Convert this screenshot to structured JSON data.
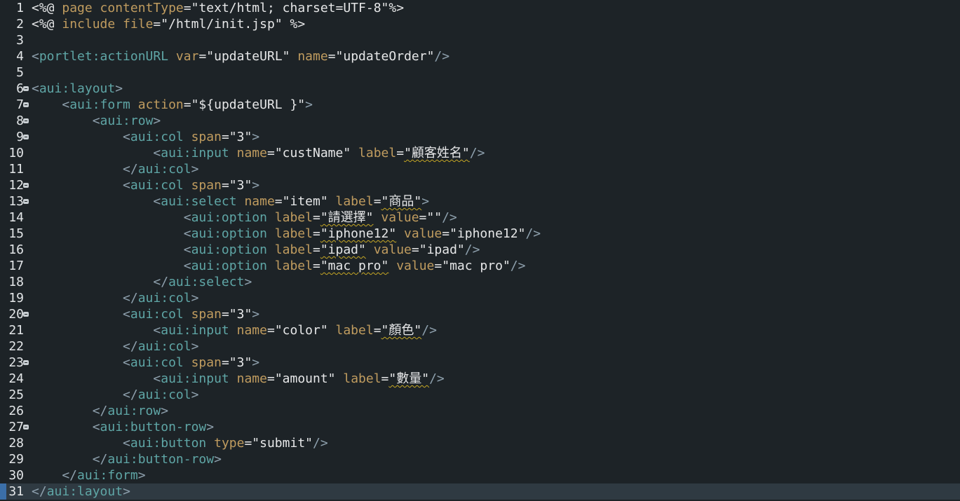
{
  "editor": {
    "lines": [
      {
        "num": "1",
        "fold": false,
        "current": false,
        "tokens": [
          {
            "t": "<%@ ",
            "c": "dir"
          },
          {
            "t": "page ",
            "c": "attr"
          },
          {
            "t": "contentType",
            "c": "attr"
          },
          {
            "t": "=",
            "c": "eq"
          },
          {
            "t": "\"text/html; charset=UTF-8\"",
            "c": "str"
          },
          {
            "t": "%>",
            "c": "dir"
          }
        ]
      },
      {
        "num": "2",
        "fold": false,
        "current": false,
        "tokens": [
          {
            "t": "<%@ ",
            "c": "dir"
          },
          {
            "t": "include ",
            "c": "attr"
          },
          {
            "t": "file",
            "c": "attr"
          },
          {
            "t": "=",
            "c": "eq"
          },
          {
            "t": "\"/html/init.jsp\"",
            "c": "str"
          },
          {
            "t": " %>",
            "c": "dir"
          }
        ]
      },
      {
        "num": "3",
        "fold": false,
        "current": false,
        "tokens": []
      },
      {
        "num": "4",
        "fold": false,
        "current": false,
        "tokens": [
          {
            "t": "<",
            "c": "br"
          },
          {
            "t": "portlet:actionURL",
            "c": "tag"
          },
          {
            "t": " var",
            "c": "attr"
          },
          {
            "t": "=",
            "c": "eq"
          },
          {
            "t": "\"updateURL\"",
            "c": "str"
          },
          {
            "t": " name",
            "c": "attr"
          },
          {
            "t": "=",
            "c": "eq"
          },
          {
            "t": "\"updateOrder\"",
            "c": "str"
          },
          {
            "t": "/>",
            "c": "br"
          }
        ]
      },
      {
        "num": "5",
        "fold": false,
        "current": false,
        "tokens": []
      },
      {
        "num": "6",
        "fold": true,
        "current": false,
        "tokens": [
          {
            "t": "<",
            "c": "br"
          },
          {
            "t": "aui:layout",
            "c": "tag"
          },
          {
            "t": ">",
            "c": "br"
          }
        ]
      },
      {
        "num": "7",
        "fold": true,
        "current": false,
        "tokens": [
          {
            "t": "    <",
            "c": "br"
          },
          {
            "t": "aui:form",
            "c": "tag"
          },
          {
            "t": " action",
            "c": "attr"
          },
          {
            "t": "=",
            "c": "eq"
          },
          {
            "t": "\"${updateURL }\"",
            "c": "str"
          },
          {
            "t": ">",
            "c": "br"
          }
        ]
      },
      {
        "num": "8",
        "fold": true,
        "current": false,
        "tokens": [
          {
            "t": "        <",
            "c": "br"
          },
          {
            "t": "aui:row",
            "c": "tag"
          },
          {
            "t": ">",
            "c": "br"
          }
        ]
      },
      {
        "num": "9",
        "fold": true,
        "current": false,
        "tokens": [
          {
            "t": "            <",
            "c": "br"
          },
          {
            "t": "aui:col",
            "c": "tag"
          },
          {
            "t": " span",
            "c": "attr"
          },
          {
            "t": "=",
            "c": "eq"
          },
          {
            "t": "\"3\"",
            "c": "str"
          },
          {
            "t": ">",
            "c": "br"
          }
        ]
      },
      {
        "num": "10",
        "fold": false,
        "current": false,
        "tokens": [
          {
            "t": "                <",
            "c": "br"
          },
          {
            "t": "aui:input",
            "c": "tag"
          },
          {
            "t": " name",
            "c": "attr"
          },
          {
            "t": "=",
            "c": "eq"
          },
          {
            "t": "\"custName\"",
            "c": "str"
          },
          {
            "t": " label",
            "c": "attr"
          },
          {
            "t": "=",
            "c": "eq"
          },
          {
            "t": "\"顧客姓名\"",
            "c": "str",
            "spell": true
          },
          {
            "t": "/>",
            "c": "br"
          }
        ]
      },
      {
        "num": "11",
        "fold": false,
        "current": false,
        "tokens": [
          {
            "t": "            </",
            "c": "br"
          },
          {
            "t": "aui:col",
            "c": "tag"
          },
          {
            "t": ">",
            "c": "br"
          }
        ]
      },
      {
        "num": "12",
        "fold": true,
        "current": false,
        "tokens": [
          {
            "t": "            <",
            "c": "br"
          },
          {
            "t": "aui:col",
            "c": "tag"
          },
          {
            "t": " span",
            "c": "attr"
          },
          {
            "t": "=",
            "c": "eq"
          },
          {
            "t": "\"3\"",
            "c": "str"
          },
          {
            "t": ">",
            "c": "br"
          }
        ]
      },
      {
        "num": "13",
        "fold": true,
        "current": false,
        "tokens": [
          {
            "t": "                <",
            "c": "br"
          },
          {
            "t": "aui:select",
            "c": "tag"
          },
          {
            "t": " name",
            "c": "attr"
          },
          {
            "t": "=",
            "c": "eq"
          },
          {
            "t": "\"item\"",
            "c": "str"
          },
          {
            "t": " label",
            "c": "attr"
          },
          {
            "t": "=",
            "c": "eq"
          },
          {
            "t": "\"商品\"",
            "c": "str",
            "spell": true
          },
          {
            "t": ">",
            "c": "br"
          }
        ]
      },
      {
        "num": "14",
        "fold": false,
        "current": false,
        "tokens": [
          {
            "t": "                    <",
            "c": "br"
          },
          {
            "t": "aui:option",
            "c": "tag"
          },
          {
            "t": " label",
            "c": "attr"
          },
          {
            "t": "=",
            "c": "eq"
          },
          {
            "t": "\"請選擇\"",
            "c": "str",
            "spell": true
          },
          {
            "t": " value",
            "c": "attr"
          },
          {
            "t": "=",
            "c": "eq"
          },
          {
            "t": "\"\"",
            "c": "str"
          },
          {
            "t": "/>",
            "c": "br"
          }
        ]
      },
      {
        "num": "15",
        "fold": false,
        "current": false,
        "tokens": [
          {
            "t": "                    <",
            "c": "br"
          },
          {
            "t": "aui:option",
            "c": "tag"
          },
          {
            "t": " label",
            "c": "attr"
          },
          {
            "t": "=",
            "c": "eq"
          },
          {
            "t": "\"iphone12\"",
            "c": "str",
            "spell": true
          },
          {
            "t": " value",
            "c": "attr"
          },
          {
            "t": "=",
            "c": "eq"
          },
          {
            "t": "\"iphone12\"",
            "c": "str"
          },
          {
            "t": "/>",
            "c": "br"
          }
        ]
      },
      {
        "num": "16",
        "fold": false,
        "current": false,
        "tokens": [
          {
            "t": "                    <",
            "c": "br"
          },
          {
            "t": "aui:option",
            "c": "tag"
          },
          {
            "t": " label",
            "c": "attr"
          },
          {
            "t": "=",
            "c": "eq"
          },
          {
            "t": "\"ipad\"",
            "c": "str",
            "spell": true
          },
          {
            "t": " value",
            "c": "attr"
          },
          {
            "t": "=",
            "c": "eq"
          },
          {
            "t": "\"ipad\"",
            "c": "str"
          },
          {
            "t": "/>",
            "c": "br"
          }
        ]
      },
      {
        "num": "17",
        "fold": false,
        "current": false,
        "tokens": [
          {
            "t": "                    <",
            "c": "br"
          },
          {
            "t": "aui:option",
            "c": "tag"
          },
          {
            "t": " label",
            "c": "attr"
          },
          {
            "t": "=",
            "c": "eq"
          },
          {
            "t": "\"mac pro\"",
            "c": "str",
            "spell": true
          },
          {
            "t": " value",
            "c": "attr"
          },
          {
            "t": "=",
            "c": "eq"
          },
          {
            "t": "\"mac pro\"",
            "c": "str"
          },
          {
            "t": "/>",
            "c": "br"
          }
        ]
      },
      {
        "num": "18",
        "fold": false,
        "current": false,
        "tokens": [
          {
            "t": "                </",
            "c": "br"
          },
          {
            "t": "aui:select",
            "c": "tag"
          },
          {
            "t": ">",
            "c": "br"
          }
        ]
      },
      {
        "num": "19",
        "fold": false,
        "current": false,
        "tokens": [
          {
            "t": "            </",
            "c": "br"
          },
          {
            "t": "aui:col",
            "c": "tag"
          },
          {
            "t": ">",
            "c": "br"
          }
        ]
      },
      {
        "num": "20",
        "fold": true,
        "current": false,
        "tokens": [
          {
            "t": "            <",
            "c": "br"
          },
          {
            "t": "aui:col",
            "c": "tag"
          },
          {
            "t": " span",
            "c": "attr"
          },
          {
            "t": "=",
            "c": "eq"
          },
          {
            "t": "\"3\"",
            "c": "str"
          },
          {
            "t": ">",
            "c": "br"
          }
        ]
      },
      {
        "num": "21",
        "fold": false,
        "current": false,
        "tokens": [
          {
            "t": "                <",
            "c": "br"
          },
          {
            "t": "aui:input",
            "c": "tag"
          },
          {
            "t": " name",
            "c": "attr"
          },
          {
            "t": "=",
            "c": "eq"
          },
          {
            "t": "\"color\"",
            "c": "str"
          },
          {
            "t": " label",
            "c": "attr"
          },
          {
            "t": "=",
            "c": "eq"
          },
          {
            "t": "\"顏色\"",
            "c": "str",
            "spell": true
          },
          {
            "t": "/>",
            "c": "br"
          }
        ]
      },
      {
        "num": "22",
        "fold": false,
        "current": false,
        "tokens": [
          {
            "t": "            </",
            "c": "br"
          },
          {
            "t": "aui:col",
            "c": "tag"
          },
          {
            "t": ">",
            "c": "br"
          }
        ]
      },
      {
        "num": "23",
        "fold": true,
        "current": false,
        "tokens": [
          {
            "t": "            <",
            "c": "br"
          },
          {
            "t": "aui:col",
            "c": "tag"
          },
          {
            "t": " span",
            "c": "attr"
          },
          {
            "t": "=",
            "c": "eq"
          },
          {
            "t": "\"3\"",
            "c": "str"
          },
          {
            "t": ">",
            "c": "br"
          }
        ]
      },
      {
        "num": "24",
        "fold": false,
        "current": false,
        "tokens": [
          {
            "t": "                <",
            "c": "br"
          },
          {
            "t": "aui:input",
            "c": "tag"
          },
          {
            "t": " name",
            "c": "attr"
          },
          {
            "t": "=",
            "c": "eq"
          },
          {
            "t": "\"amount\"",
            "c": "str"
          },
          {
            "t": " label",
            "c": "attr"
          },
          {
            "t": "=",
            "c": "eq"
          },
          {
            "t": "\"數量\"",
            "c": "str",
            "spell": true
          },
          {
            "t": "/>",
            "c": "br"
          }
        ]
      },
      {
        "num": "25",
        "fold": false,
        "current": false,
        "tokens": [
          {
            "t": "            </",
            "c": "br"
          },
          {
            "t": "aui:col",
            "c": "tag"
          },
          {
            "t": ">",
            "c": "br"
          }
        ]
      },
      {
        "num": "26",
        "fold": false,
        "current": false,
        "tokens": [
          {
            "t": "        </",
            "c": "br"
          },
          {
            "t": "aui:row",
            "c": "tag"
          },
          {
            "t": ">",
            "c": "br"
          }
        ]
      },
      {
        "num": "27",
        "fold": true,
        "current": false,
        "tokens": [
          {
            "t": "        <",
            "c": "br"
          },
          {
            "t": "aui:button-row",
            "c": "tag"
          },
          {
            "t": ">",
            "c": "br"
          }
        ]
      },
      {
        "num": "28",
        "fold": false,
        "current": false,
        "tokens": [
          {
            "t": "            <",
            "c": "br"
          },
          {
            "t": "aui:button",
            "c": "tag"
          },
          {
            "t": " type",
            "c": "attr"
          },
          {
            "t": "=",
            "c": "eq"
          },
          {
            "t": "\"submit\"",
            "c": "str"
          },
          {
            "t": "/>",
            "c": "br"
          }
        ]
      },
      {
        "num": "29",
        "fold": false,
        "current": false,
        "tokens": [
          {
            "t": "        </",
            "c": "br"
          },
          {
            "t": "aui:button-row",
            "c": "tag"
          },
          {
            "t": ">",
            "c": "br"
          }
        ]
      },
      {
        "num": "30",
        "fold": false,
        "current": false,
        "tokens": [
          {
            "t": "    </",
            "c": "br"
          },
          {
            "t": "aui:form",
            "c": "tag"
          },
          {
            "t": ">",
            "c": "br"
          }
        ]
      },
      {
        "num": "31",
        "fold": false,
        "current": true,
        "tokens": [
          {
            "t": "</",
            "c": "br"
          },
          {
            "t": "aui:layout",
            "c": "tag"
          },
          {
            "t": ">",
            "c": "br"
          }
        ]
      }
    ]
  }
}
